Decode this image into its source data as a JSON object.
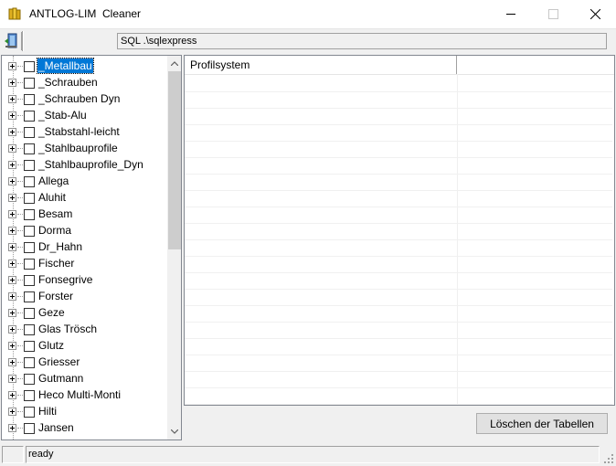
{
  "window": {
    "title": "ANTLOG-LIM  Cleaner",
    "icon": "app-db-icon",
    "controls": [
      "minimize",
      "maximize",
      "close"
    ]
  },
  "toolbar": {
    "exit_icon": "exit-door-icon",
    "connection": "SQL .\\sqlexpress"
  },
  "tree": {
    "items": [
      {
        "label": "_Metallbau",
        "selected": true
      },
      {
        "label": "_Schrauben"
      },
      {
        "label": "_Schrauben Dyn"
      },
      {
        "label": "_Stab-Alu"
      },
      {
        "label": "_Stabstahl-leicht"
      },
      {
        "label": "_Stahlbauprofile"
      },
      {
        "label": "_Stahlbauprofile_Dyn"
      },
      {
        "label": "Allega"
      },
      {
        "label": "Aluhit"
      },
      {
        "label": "Besam"
      },
      {
        "label": "Dorma"
      },
      {
        "label": "Dr_Hahn"
      },
      {
        "label": "Fischer"
      },
      {
        "label": "Fonsegrive"
      },
      {
        "label": "Forster"
      },
      {
        "label": "Geze"
      },
      {
        "label": "Glas Trösch"
      },
      {
        "label": "Glutz"
      },
      {
        "label": "Griesser"
      },
      {
        "label": "Gutmann"
      },
      {
        "label": "Heco Multi-Monti"
      },
      {
        "label": "Hilti"
      },
      {
        "label": "Jansen"
      },
      {
        "label": ""
      }
    ]
  },
  "grid": {
    "columns": [
      "Profilsystem",
      ""
    ],
    "rows": 20
  },
  "delete_button": "Löschen der Tabellen",
  "status": {
    "text": "ready"
  },
  "colors": {
    "selection": "#0078d7",
    "background": "#f0f0f0"
  }
}
